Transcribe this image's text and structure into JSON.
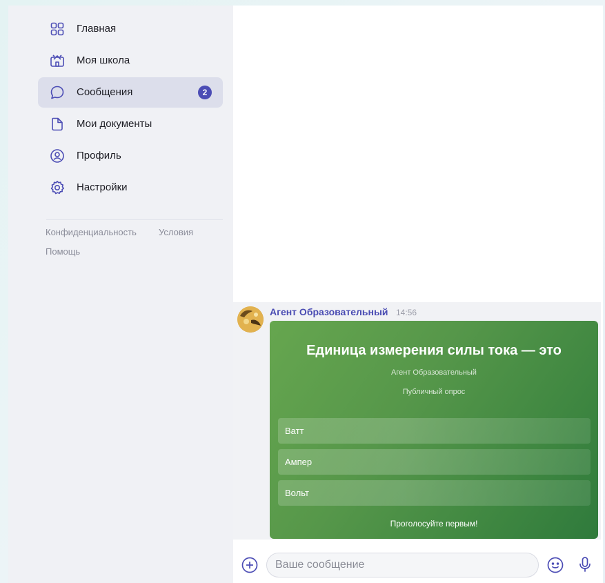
{
  "sidebar": {
    "items": [
      {
        "label": "Главная",
        "icon": "grid-icon"
      },
      {
        "label": "Моя школа",
        "icon": "school-icon"
      },
      {
        "label": "Сообщения",
        "icon": "chat-bubble-icon",
        "badge": "2",
        "active": true
      },
      {
        "label": "Мои документы",
        "icon": "document-icon"
      },
      {
        "label": "Профиль",
        "icon": "profile-icon"
      },
      {
        "label": "Настройки",
        "icon": "gear-icon"
      }
    ],
    "footer": {
      "privacy": "Конфиденциальность",
      "terms": "Условия",
      "help": "Помощь"
    }
  },
  "chat": {
    "message": {
      "sender": "Агент Образовательный",
      "time": "14:56",
      "poll": {
        "question": "Единица измерения силы тока — это",
        "author": "Агент Образовательный",
        "kind": "Публичный опрос",
        "options": [
          "Ватт",
          "Ампер",
          "Вольт"
        ],
        "vote_prompt": "Проголосуйте первым!"
      }
    },
    "input": {
      "placeholder": "Ваше сообщение"
    }
  },
  "colors": {
    "accent": "#4c4db5",
    "poll_green": "#4a8f45",
    "sidebar_bg": "#f0f1f5",
    "active_item_bg": "#dcdeeb"
  }
}
